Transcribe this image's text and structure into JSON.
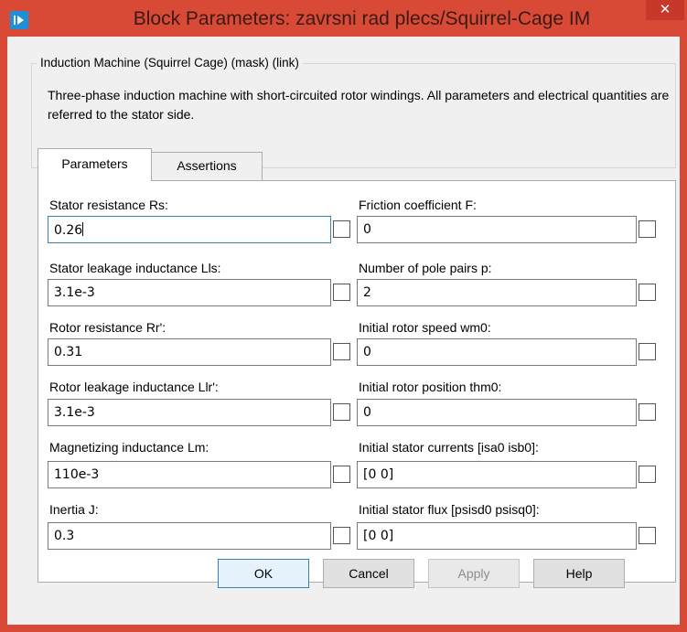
{
  "window": {
    "title": "Block Parameters: zavrsni rad plecs/Squirrel-Cage IM",
    "close_label": "✕",
    "accent_color": "#d84a35"
  },
  "mask": {
    "legend": "Induction Machine (Squirrel Cage) (mask) (link)",
    "description": "Three-phase induction machine with short-circuited rotor windings. All parameters and electrical quantities are referred to the stator side."
  },
  "tabs": [
    {
      "label": "Parameters",
      "active": true
    },
    {
      "label": "Assertions",
      "active": false
    }
  ],
  "params_left": [
    {
      "label": "Stator resistance Rs:",
      "value": "0.26"
    },
    {
      "label": "Stator leakage inductance Lls:",
      "value": "3.1e-3"
    },
    {
      "label": "Rotor resistance Rr':",
      "value": "0.31"
    },
    {
      "label": "Rotor leakage inductance Llr':",
      "value": "3.1e-3"
    },
    {
      "label": "Magnetizing inductance Lm:",
      "value": "110e-3"
    },
    {
      "label": "Inertia J:",
      "value": "0.3"
    }
  ],
  "params_right": [
    {
      "label": "Friction coefficient F:",
      "value": "0"
    },
    {
      "label": "Number of pole pairs p:",
      "value": "2"
    },
    {
      "label": "Initial rotor speed wm0:",
      "value": "0"
    },
    {
      "label": "Initial rotor position thm0:",
      "value": "0"
    },
    {
      "label": "Initial stator currents [isa0 isb0]:",
      "value": "[0 0]"
    },
    {
      "label": "Initial stator flux [psisd0 psisq0]:",
      "value": "[0 0]"
    }
  ],
  "buttons": {
    "ok": "OK",
    "cancel": "Cancel",
    "apply": "Apply",
    "help": "Help"
  }
}
